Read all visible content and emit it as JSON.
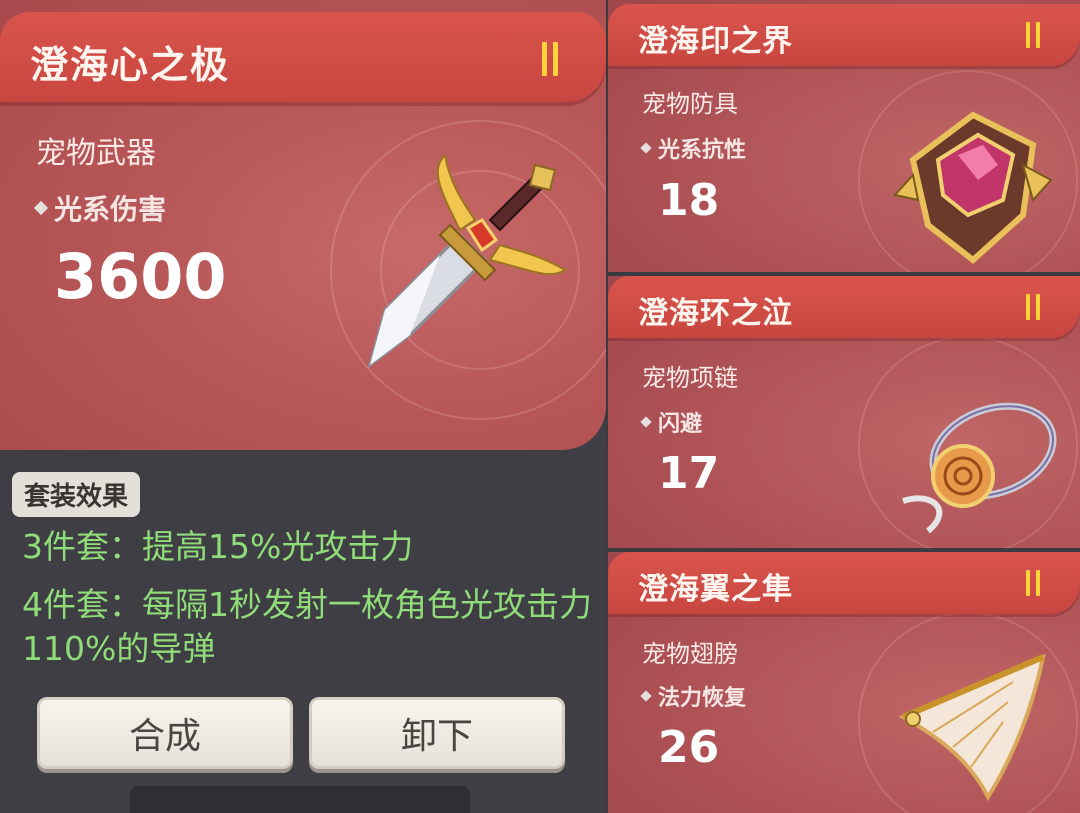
{
  "main_item": {
    "name": "澄海心之极",
    "type": "宠物武器",
    "stat_label": "光系伤害",
    "stat_value": "3600",
    "icon": "sword-icon"
  },
  "set_effect": {
    "badge": "套装效果",
    "line_3": "3件套：提高15%光攻击力",
    "line_4": "4件套：每隔1秒发射一枚角色光攻击力110%的导弹",
    "color": "#8fdc78"
  },
  "buttons": {
    "merge": "合成",
    "unequip": "卸下"
  },
  "side_items": [
    {
      "name": "澄海印之界",
      "type": "宠物防具",
      "stat_label": "光系抗性",
      "stat_value": "18",
      "icon": "shield-icon"
    },
    {
      "name": "澄海环之泣",
      "type": "宠物项链",
      "stat_label": "闪避",
      "stat_value": "17",
      "icon": "necklace-icon"
    },
    {
      "name": "澄海翼之隼",
      "type": "宠物翅膀",
      "stat_label": "法力恢复",
      "stat_value": "26",
      "icon": "wing-icon"
    }
  ],
  "colors": {
    "header_red": "#d9554c",
    "card_red": "#b85757",
    "pause_yellow": "#ffd33a",
    "panel_dark": "#3e3e44"
  }
}
